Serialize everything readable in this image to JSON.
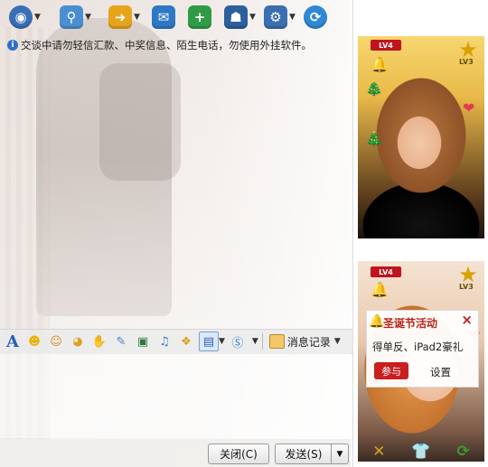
{
  "toolbar": {
    "items": [
      {
        "icon": "webcam-icon",
        "color": "#3a6fb5"
      },
      {
        "icon": "microphone-icon",
        "color": "#4a8fd1"
      },
      {
        "icon": "send-file-icon",
        "color": "#e6a31c"
      },
      {
        "icon": "message-icon",
        "color": "#2e78c4"
      },
      {
        "icon": "add-app-icon",
        "color": "#2f9b47"
      },
      {
        "icon": "user-profile-icon",
        "color": "#2c5f9c"
      },
      {
        "icon": "settings-icon",
        "color": "#3b6fb1"
      },
      {
        "icon": "share-icon",
        "color": "#2e88d6"
      }
    ]
  },
  "notice": {
    "text": "交谈中请勿轻信汇款、中奖信息、陌生电话，勿使用外挂软件。"
  },
  "input_toolbar": {
    "font_label": "A",
    "history_label": "消息记录"
  },
  "buttons": {
    "close_label": "关闭(C)",
    "send_label": "发送(S)"
  },
  "sidebar": {
    "level_badge": "LV4",
    "level_star": "LV3"
  },
  "xmas_popup": {
    "title": "圣诞节活动",
    "text": "得单反、iPad2豪礼",
    "join_label": "参与",
    "settings_label": "设置"
  }
}
